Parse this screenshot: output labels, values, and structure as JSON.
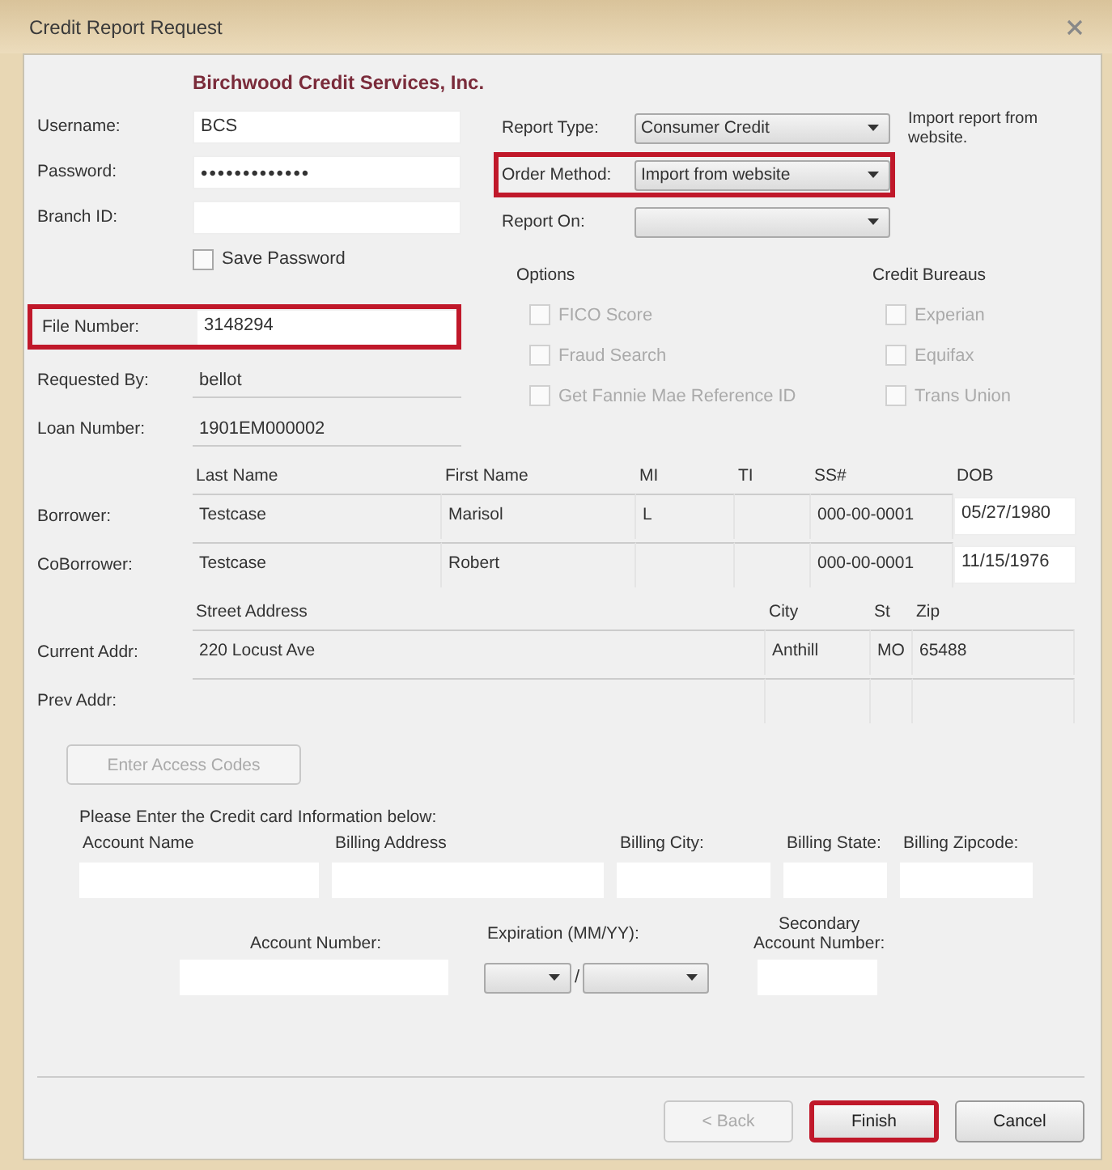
{
  "window": {
    "title": "Credit Report Request"
  },
  "company": "Birchwood Credit Services, Inc.",
  "login": [
    {
      "label": "Username:",
      "value": "BCS"
    },
    {
      "label": "Password:",
      "value": "•••••••••••••"
    },
    {
      "label": "Branch ID:"
    }
  ],
  "save_password": {
    "label": "Save Password",
    "checked": false
  },
  "report": [
    {
      "label": "Report Type:",
      "value": "Consumer Credit"
    },
    {
      "label": "Order Method:",
      "value": "Import from website",
      "highlighted": true
    },
    {
      "label": "Report On:"
    }
  ],
  "report_note": "Import report from website.",
  "file_number": {
    "label": "File Number:",
    "value": "3148294",
    "highlighted": true
  },
  "requested_by": {
    "label": "Requested By:",
    "value": "bellot"
  },
  "loan_number": {
    "label": "Loan Number:",
    "value": "1901EM000002"
  },
  "options": {
    "title": "Options",
    "items": [
      {
        "label": "FICO Score",
        "checked": false,
        "disabled": true
      },
      {
        "label": "Fraud Search",
        "checked": false,
        "disabled": true
      },
      {
        "label": "Get Fannie Mae Reference ID",
        "checked": false,
        "disabled": true
      }
    ]
  },
  "credit_bureau": {
    "title": "Credit Bureaus",
    "items": [
      {
        "label": "Experian",
        "checked": false,
        "disabled": true
      },
      {
        "label": "Equifax",
        "checked": false,
        "disabled": true
      },
      {
        "label": "Trans Union",
        "checked": false,
        "disabled": true
      }
    ]
  },
  "borrowers": {
    "columns": [
      "Last Name",
      "First Name",
      "MI",
      "TI",
      "SS#",
      "DOB"
    ],
    "rows": [
      {
        "label": "Borrower:",
        "last_name": "Testcase",
        "first_name": "Marisol",
        "mi": "L",
        "ss": "000-00-0001",
        "dob": "05/27/1980"
      },
      {
        "label": "CoBorrower:",
        "last_name": "Testcase",
        "first_name": "Robert",
        "ss": "000-00-0001",
        "dob": "11/15/1976"
      }
    ]
  },
  "addresses": {
    "columns": [
      "Street Address",
      "City",
      "St",
      "Zip"
    ],
    "rows": [
      {
        "label": "Current Addr:",
        "street": "220 Locust Ave",
        "city": "Anthill",
        "st": "MO",
        "zip": "65488"
      },
      {
        "label": "Prev Addr:"
      }
    ]
  },
  "access_button": {
    "label": "Enter Access Codes",
    "disabled": true
  },
  "credit_card": {
    "instruction": "Please Enter the Credit card Information below:",
    "fields": [
      {
        "label": "Account Name"
      },
      {
        "label": "Billing Address"
      },
      {
        "label": "Billing City:"
      },
      {
        "label": "Billing State:"
      },
      {
        "label": "Billing Zipcode:"
      }
    ],
    "account_number": {
      "label": "Account Number:"
    },
    "expiration": {
      "label": "Expiration (MM/YY):",
      "separator": "/"
    },
    "secondary": {
      "label": "Secondary Account Number:"
    }
  },
  "buttons": [
    {
      "label": "< Back",
      "disabled": true,
      "highlighted": false
    },
    {
      "label": "Finish",
      "disabled": false,
      "highlighted": true
    },
    {
      "label": "Cancel",
      "disabled": false,
      "highlighted": false
    }
  ]
}
